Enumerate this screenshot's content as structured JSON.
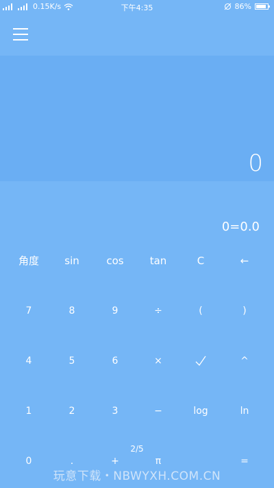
{
  "status_bar": {
    "carrier_text": "4G",
    "network_speed": "0.15K/s",
    "time": "下午4:35",
    "battery_percent": "86%",
    "battery_level": 0.86,
    "icons": [
      "signal-icon",
      "wifi-icon",
      "alarm-icon",
      "battery-icon"
    ]
  },
  "header": {
    "menu_icon": "hamburger-menu-icon"
  },
  "display": {
    "value": "0",
    "expression": "0=0.0"
  },
  "keypad": {
    "rows": [
      [
        "角度",
        "sin",
        "cos",
        "tan",
        "C",
        "←"
      ],
      [
        "7",
        "8",
        "9",
        "÷",
        "(",
        ")"
      ],
      [
        "4",
        "5",
        "6",
        "×",
        "√",
        "^"
      ],
      [
        "1",
        "2",
        "3",
        "−",
        "log",
        "ln"
      ],
      [
        "0",
        ".",
        "+",
        "π",
        "",
        "="
      ]
    ]
  },
  "page_indicator": "2/5",
  "watermark": "玩意下载・NBWYXH.COM.CN",
  "colors": {
    "background": "#75b6f6",
    "display_background": "#6aaef3",
    "text": "#ffffff"
  }
}
